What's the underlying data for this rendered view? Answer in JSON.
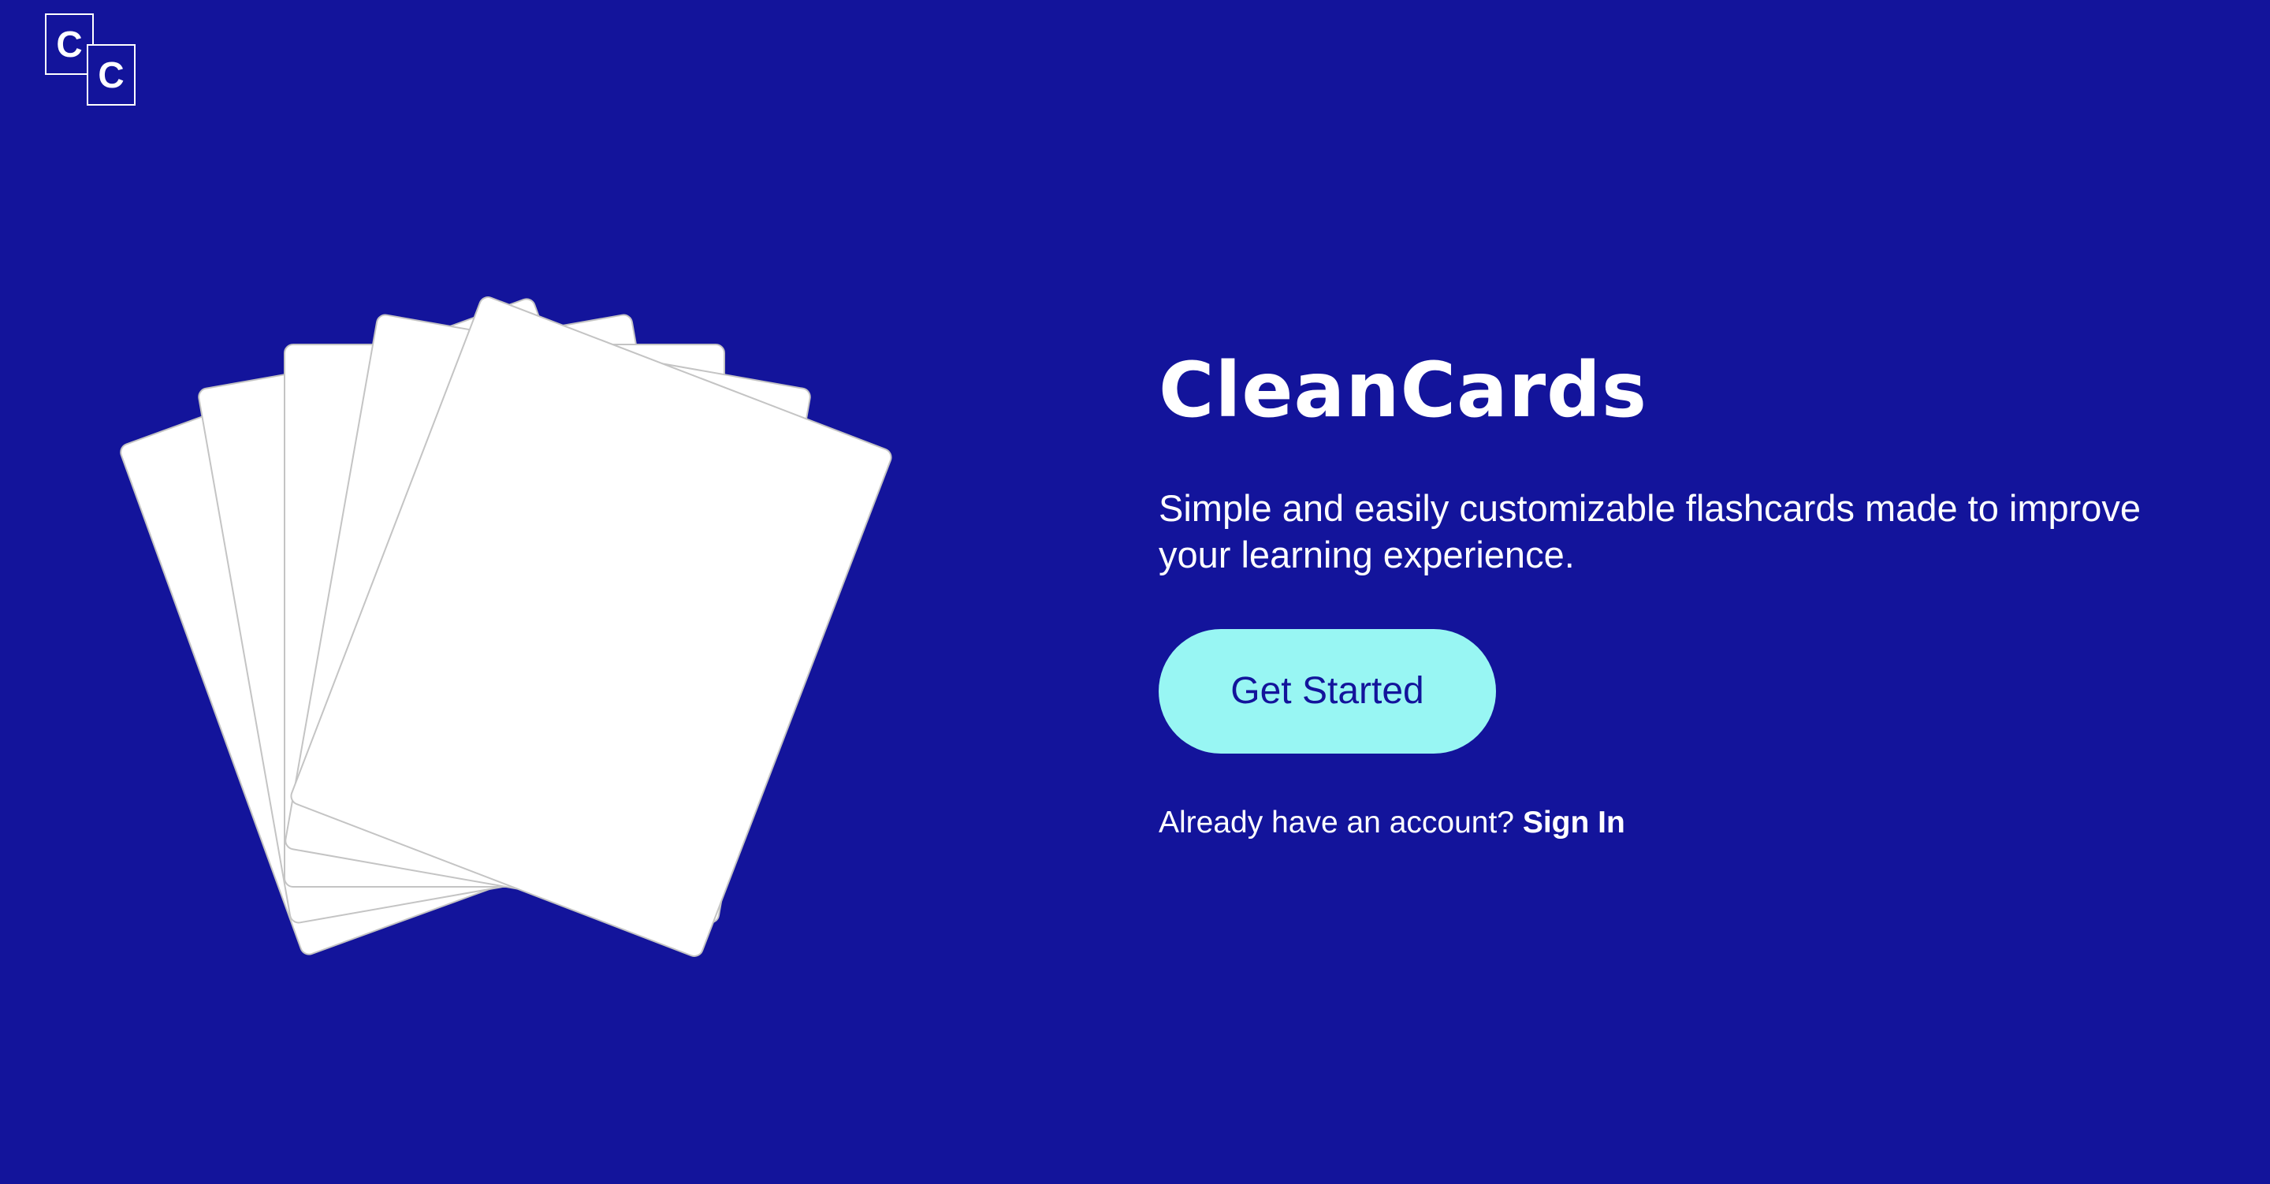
{
  "logo": {
    "letter_a": "C",
    "letter_b": "C"
  },
  "hero": {
    "title": "CleanCards",
    "tagline": "Simple and easily customizable flashcards made to improve your learning experience.",
    "cta_label": "Get Started",
    "signin_prompt": "Already have an account?",
    "signin_label": "Sign In"
  },
  "colors": {
    "background": "#13149b",
    "cta_background": "#98f6f3",
    "cta_text": "#13149b",
    "card": "#ffffff",
    "card_border": "#c4c4c4"
  },
  "icons": {
    "logo": "cleancards-logo-icon",
    "illustration": "flashcard-fan-illustration"
  }
}
